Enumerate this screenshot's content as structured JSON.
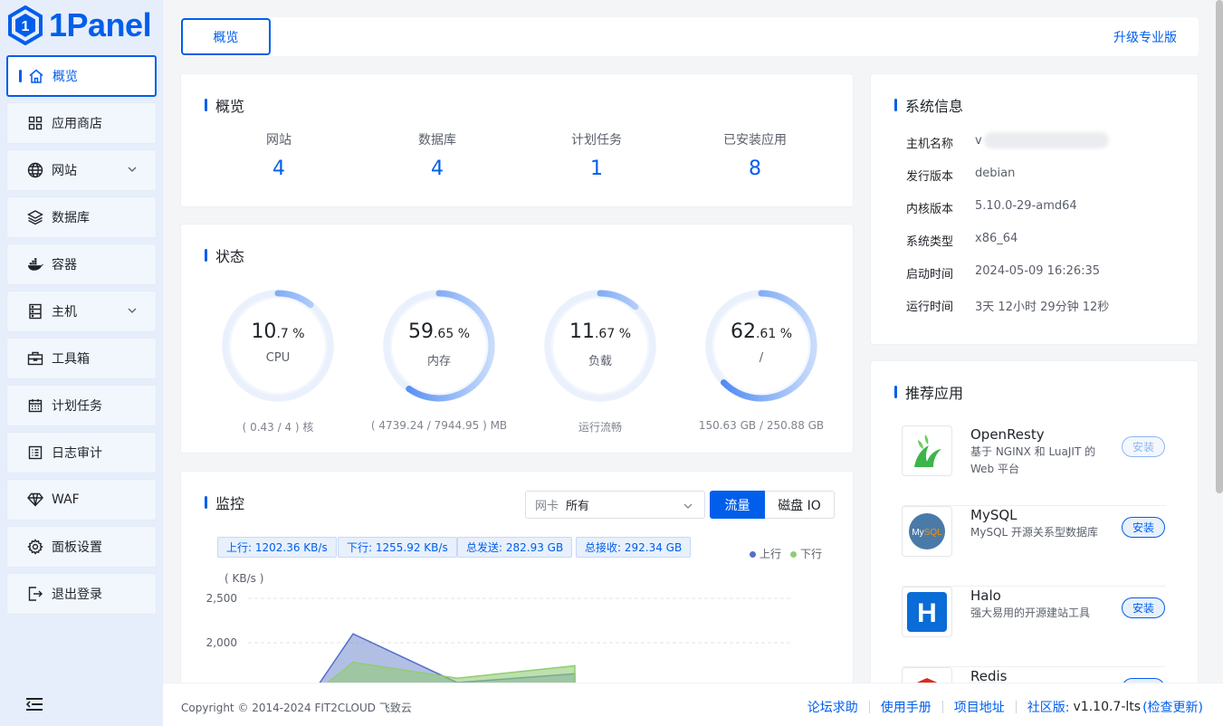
{
  "brand": {
    "name": "1Panel"
  },
  "sidebar": {
    "items": [
      {
        "label": "概览",
        "icon": "home-icon",
        "active": true
      },
      {
        "label": "应用商店",
        "icon": "grid-icon"
      },
      {
        "label": "网站",
        "icon": "globe-icon",
        "expandable": true
      },
      {
        "label": "数据库",
        "icon": "layers-icon"
      },
      {
        "label": "容器",
        "icon": "docker-icon"
      },
      {
        "label": "主机",
        "icon": "server-icon",
        "expandable": true
      },
      {
        "label": "工具箱",
        "icon": "toolbox-icon"
      },
      {
        "label": "计划任务",
        "icon": "calendar-icon"
      },
      {
        "label": "日志审计",
        "icon": "log-icon"
      },
      {
        "label": "WAF",
        "icon": "diamond-icon"
      },
      {
        "label": "面板设置",
        "icon": "gear-icon"
      },
      {
        "label": "退出登录",
        "icon": "logout-icon"
      }
    ]
  },
  "topbar": {
    "tab": "概览",
    "upgrade": "升级专业版"
  },
  "overview": {
    "title": "概览",
    "stats": [
      {
        "label": "网站",
        "value": "4"
      },
      {
        "label": "数据库",
        "value": "4"
      },
      {
        "label": "计划任务",
        "value": "1"
      },
      {
        "label": "已安装应用",
        "value": "8"
      }
    ]
  },
  "status": {
    "title": "状态",
    "gauges": [
      {
        "int": "10",
        "dec": ".7 %",
        "label": "CPU",
        "sub": "( 0.43 / 4 ) 核",
        "percent": 10.7
      },
      {
        "int": "59",
        "dec": ".65 %",
        "label": "内存",
        "sub": "( 4739.24 / 7944.95 ) MB",
        "percent": 59.65
      },
      {
        "int": "11",
        "dec": ".67 %",
        "label": "负载",
        "sub": "运行流畅",
        "percent": 11.67
      },
      {
        "int": "62",
        "dec": ".61 %",
        "label": "/",
        "sub": "150.63 GB / 250.88 GB",
        "percent": 62.61
      }
    ]
  },
  "monitor": {
    "title": "监控",
    "nic_prefix": "网卡",
    "nic_value": "所有",
    "btn_traffic": "流量",
    "btn_disk": "磁盘 IO",
    "chips": [
      "上行: 1202.36 KB/s",
      "下行: 1255.92 KB/s",
      "总发送: 282.93 GB",
      "总接收: 292.34 GB"
    ],
    "legend_up": "上行",
    "legend_down": "下行",
    "unit": "( KB/s )",
    "ticks": [
      "2,500",
      "2,000"
    ]
  },
  "chart_data": {
    "type": "area",
    "ylabel": "( KB/s )",
    "yticks": [
      2000,
      2500
    ],
    "series": [
      {
        "name": "上行",
        "color": "#5470c6",
        "values": [
          1500,
          2100,
          1550,
          1650
        ]
      },
      {
        "name": "下行",
        "color": "#91cc75",
        "values": [
          1450,
          1780,
          1600,
          1740
        ]
      }
    ]
  },
  "sysinfo": {
    "title": "系统信息",
    "rows": [
      {
        "k": "主机名称",
        "v": "v"
      },
      {
        "k": "发行版本",
        "v": "debian"
      },
      {
        "k": "内核版本",
        "v": "5.10.0-29-amd64"
      },
      {
        "k": "系统类型",
        "v": "x86_64"
      },
      {
        "k": "启动时间",
        "v": "2024-05-09 16:26:35"
      },
      {
        "k": "运行时间",
        "v": "3天 12小时 29分钟 12秒"
      }
    ]
  },
  "apps": {
    "title": "推荐应用",
    "install": "安装",
    "items": [
      {
        "name": "OpenResty",
        "desc": "基于 NGINX 和 LuaJIT 的 Web 平台"
      },
      {
        "name": "MySQL",
        "desc": "MySQL 开源关系型数据库"
      },
      {
        "name": "Halo",
        "desc": "强大易用的开源建站工具"
      },
      {
        "name": "Redis",
        "desc": ""
      }
    ]
  },
  "footer": {
    "copyright": "Copyright © 2014-2024 FIT2CLOUD 飞致云",
    "links": [
      "论坛求助",
      "使用手册",
      "项目地址"
    ],
    "edition": "社区版:",
    "version": "v1.10.7-lts",
    "check": "(检查更新)"
  },
  "colors": {
    "accent": "#005eeb",
    "sidebar_bg": "#e6eefb",
    "page_bg": "#f4f5f7"
  }
}
